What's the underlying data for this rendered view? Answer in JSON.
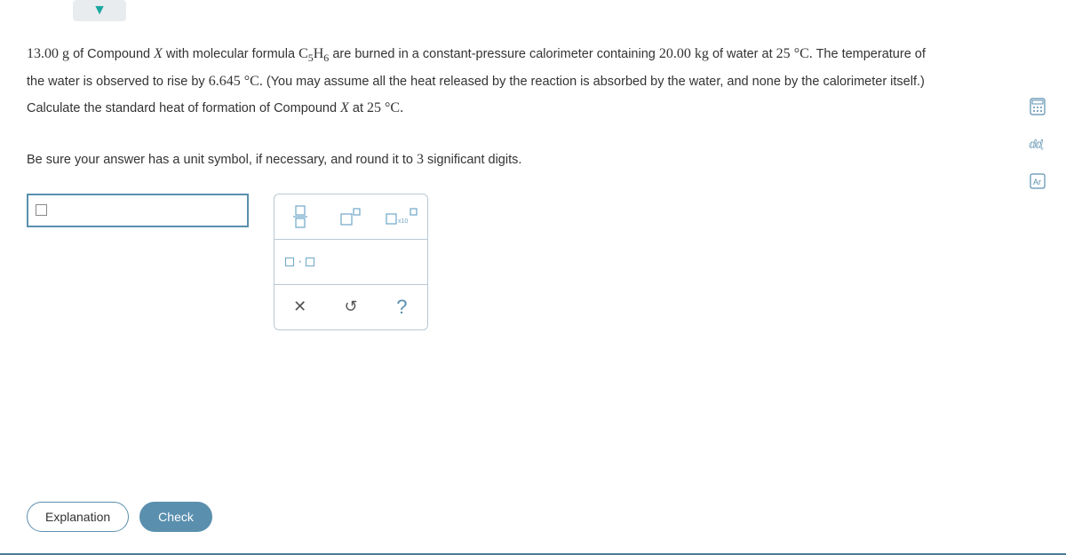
{
  "problem": {
    "mass_g": "13.00",
    "unit_g": "g",
    "of_compound": "of Compound",
    "x": "X",
    "with_formula": "with molecular formula",
    "formula_c": "C",
    "formula_c_sub": "5",
    "formula_h": "H",
    "formula_h_sub": "6",
    "line1_rest": "are burned in a constant-pressure calorimeter containing",
    "water_mass": "20.00",
    "water_unit": "kg",
    "of_water_at": "of water at",
    "temp": "25",
    "degc": "°C.",
    "line1_tail": "The temperature of",
    "line2a": "the water is observed to rise by",
    "rise": "6.645",
    "degc2": "°C.",
    "line2b": "(You may assume all the heat released by the reaction is absorbed by the water, and none by the calorimeter itself.)",
    "line3a": "Calculate the standard heat of formation of Compound",
    "at": "at",
    "temp2": "25",
    "degc3": "°C.",
    "line4": "Be sure your answer has a unit symbol, if necessary, and round it to",
    "sig": "3",
    "line4_tail": "significant digits."
  },
  "tools": {
    "fraction": "fraction",
    "superscript": "superscript",
    "scientific": "scientific",
    "multiply": "multiply",
    "clear": "clear",
    "reset": "reset",
    "help": "?"
  },
  "side": {
    "calculator": "calculator-icon",
    "ruler": "ruler-icon",
    "periodic": "periodic-icon"
  },
  "footer": {
    "explanation": "Explanation",
    "check": "Check"
  }
}
